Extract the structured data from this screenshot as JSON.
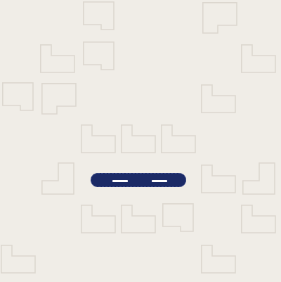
{
  "board": {
    "background": "#f0ede7",
    "piece_outline_color": "#dcd7cf"
  },
  "pieces": [
    {
      "shape": "notch-bottom-right"
    },
    {
      "shape": "notch-bottom-left"
    },
    {
      "shape": "notch-top-right"
    },
    {
      "shape": "notch-bottom-right"
    },
    {
      "shape": "notch-top-right"
    },
    {
      "shape": "notch-bottom-right"
    },
    {
      "shape": "notch-bottom-left"
    },
    {
      "shape": "notch-top-right"
    },
    {
      "shape": "notch-top-right"
    },
    {
      "shape": "notch-top-right"
    },
    {
      "shape": "notch-top-right"
    },
    {
      "shape": "notch-top-left"
    },
    {
      "shape": "notch-top-right"
    },
    {
      "shape": "notch-top-left"
    },
    {
      "shape": "notch-top-right"
    },
    {
      "shape": "notch-top-right"
    },
    {
      "shape": "notch-bottom-right"
    },
    {
      "shape": "notch-top-right"
    },
    {
      "shape": "notch-top-right"
    },
    {
      "shape": "notch-top-right"
    }
  ],
  "selected_piece": {
    "shape": "capsule",
    "color": "#1b2a66",
    "marks": 2
  }
}
